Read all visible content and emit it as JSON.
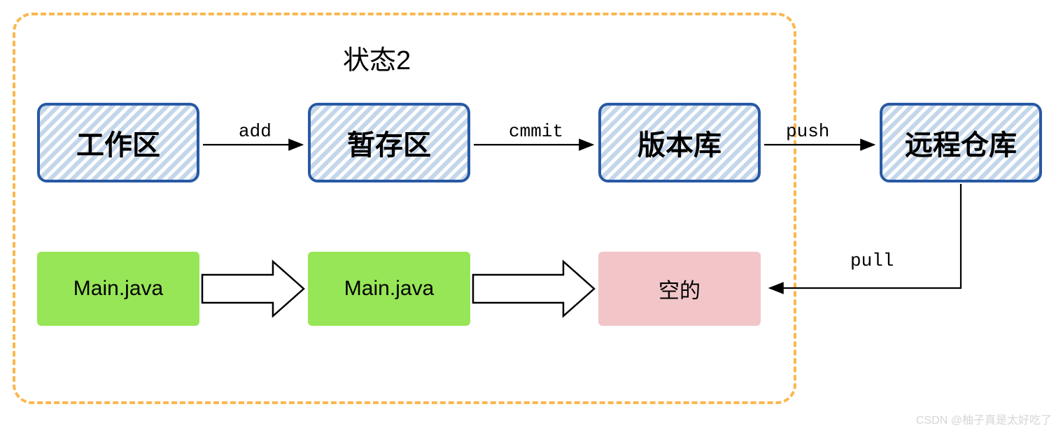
{
  "title": "状态2",
  "areas": {
    "working": {
      "label": "工作区"
    },
    "staging": {
      "label": "暂存区"
    },
    "repo": {
      "label": "版本库"
    },
    "remote": {
      "label": "远程仓库"
    }
  },
  "arrows": {
    "add": "add",
    "commit": "cmmit",
    "push": "push",
    "pull": "pull"
  },
  "contents": {
    "working_file": "Main.java",
    "staging_file": "Main.java",
    "repo_empty": "空的"
  },
  "watermark": "CSDN @柚子真是太好吃了",
  "colors": {
    "dash": "#f9b84f",
    "hatch_border": "#2859a3",
    "green": "#97e657",
    "pink": "#f2c6c9"
  }
}
